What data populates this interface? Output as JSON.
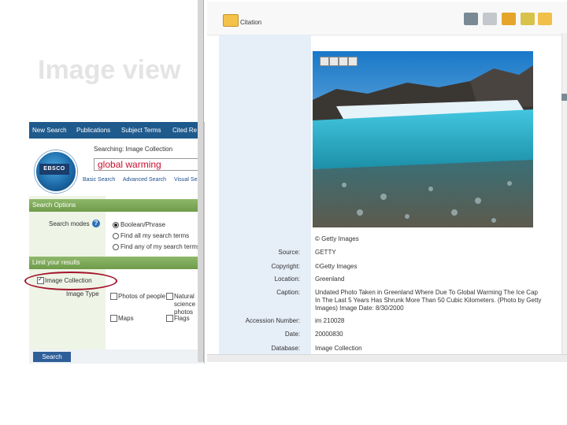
{
  "slide": {
    "title": "Image view"
  },
  "ebsco": {
    "nav": [
      "New Search",
      "Publications",
      "Subject Terms",
      "Cited Re"
    ],
    "searching": "Searching: Image Collection",
    "search_value": "global warming",
    "sublinks": [
      "Basic Search",
      "Advanced Search",
      "Visual Sea"
    ],
    "logo_text": "EBSCO",
    "search_options_header": "Search Options",
    "search_modes_label": "Search modes",
    "modes": [
      "Boolean/Phrase",
      "Find all my search terms",
      "Find any of my search terms"
    ],
    "limit_header": "Limit your results",
    "image_collection_label": "Image Collection",
    "image_type_label": "Image Type",
    "image_types": [
      "Photos of people",
      "Natural science photos",
      "Maps",
      "Flags"
    ],
    "search_button": "Search"
  },
  "citation": {
    "toolbar_label": "Citation",
    "photo_credit": "© Getty Images",
    "rows": [
      {
        "label": "Source:",
        "value": "GETTY"
      },
      {
        "label": "Copyright:",
        "value": "©Getty Images"
      },
      {
        "label": "Location:",
        "value": "Greenland"
      },
      {
        "label": "Caption:",
        "value": "Undated Photo Taken in Greenland Where Due To Global Warming The Ice Cap In The Last 5 Years Has Shrunk More Than 50 Cubic Kilometers. (Photo by Getty Images) Image Date: 8/30/2000"
      },
      {
        "label": "Accession Number:",
        "value": "im 210028"
      },
      {
        "label": "Date:",
        "value": "20000830"
      },
      {
        "label": "Database:",
        "value": "Image Collection"
      }
    ]
  },
  "colors": {
    "nav_blue": "#1f5a8c",
    "panel_green": "#7aa855",
    "oval_red": "#a3142a",
    "search_red": "#c8102e"
  }
}
